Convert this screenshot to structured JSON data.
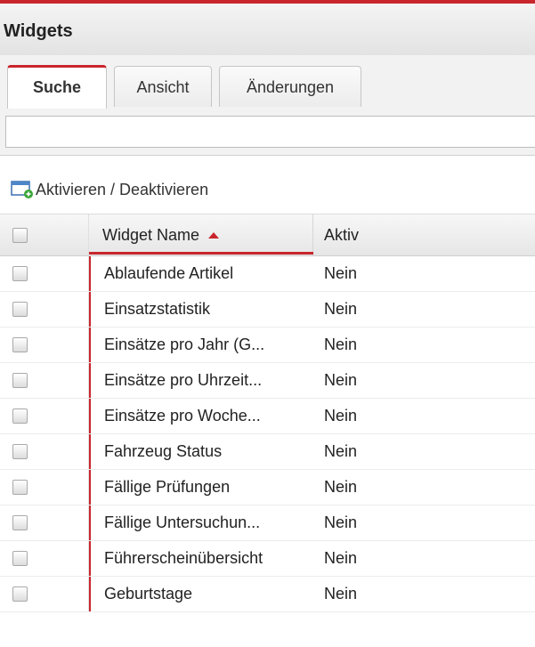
{
  "panel": {
    "title": "Widgets"
  },
  "tabs": [
    {
      "label": "Suche",
      "active": true
    },
    {
      "label": "Ansicht",
      "active": false
    },
    {
      "label": "Änderungen",
      "active": false
    }
  ],
  "search": {
    "value": "",
    "placeholder": ""
  },
  "toolbar": {
    "toggle_label": "Aktivieren / Deaktivieren",
    "icon": "add-widget-icon"
  },
  "grid": {
    "columns": {
      "name": "Widget Name",
      "aktiv": "Aktiv"
    },
    "sort": {
      "column": "name",
      "direction": "ascending"
    },
    "rows": [
      {
        "name": "Ablaufende Artikel",
        "aktiv": "Nein"
      },
      {
        "name": "Einsatzstatistik",
        "aktiv": "Nein"
      },
      {
        "name": "Einsätze pro Jahr (G...",
        "aktiv": "Nein"
      },
      {
        "name": "Einsätze pro Uhrzeit...",
        "aktiv": "Nein"
      },
      {
        "name": "Einsätze pro Woche...",
        "aktiv": "Nein"
      },
      {
        "name": "Fahrzeug Status",
        "aktiv": "Nein"
      },
      {
        "name": "Fällige Prüfungen",
        "aktiv": "Nein"
      },
      {
        "name": "Fällige Untersuchun...",
        "aktiv": "Nein"
      },
      {
        "name": "Führerscheinübersicht",
        "aktiv": "Nein"
      },
      {
        "name": "Geburtstage",
        "aktiv": "Nein"
      }
    ]
  },
  "colors": {
    "accent": "#c9252c",
    "header_bg": "#e6e6e6"
  }
}
